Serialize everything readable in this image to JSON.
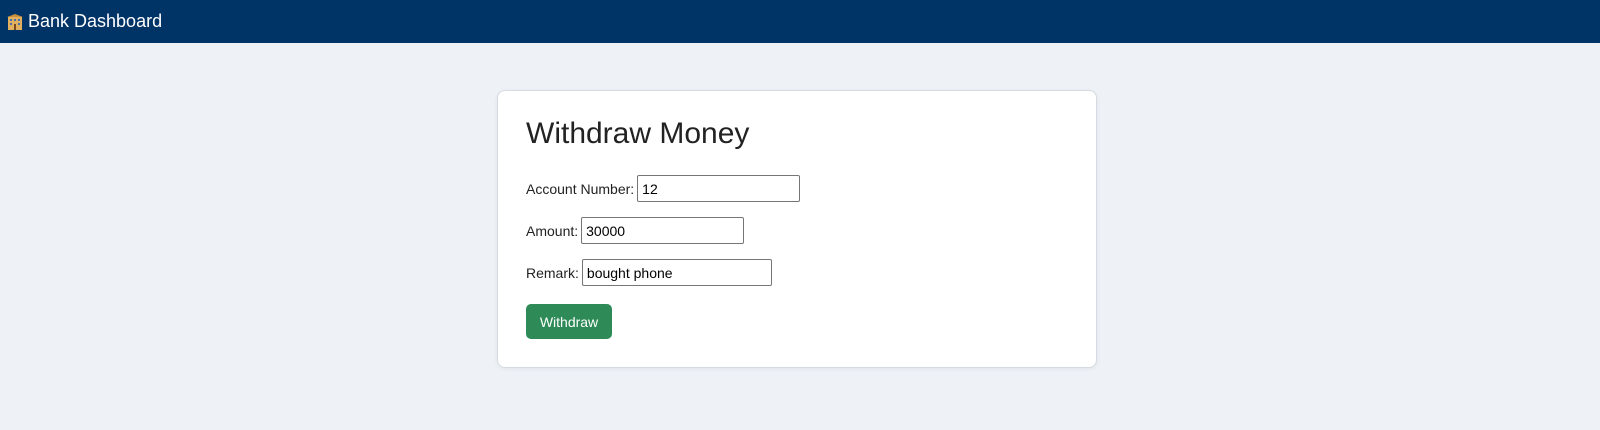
{
  "header": {
    "title": "Bank Dashboard",
    "icon": "bank-building-icon",
    "background": "#003366"
  },
  "form": {
    "title": "Withdraw Money",
    "fields": [
      {
        "label": "Account Number:",
        "value": "12"
      },
      {
        "label": "Amount:",
        "value": "30000"
      },
      {
        "label": "Remark:",
        "value": "bought phone"
      }
    ],
    "submit_label": "Withdraw",
    "submit_color": "#2e8b57"
  }
}
